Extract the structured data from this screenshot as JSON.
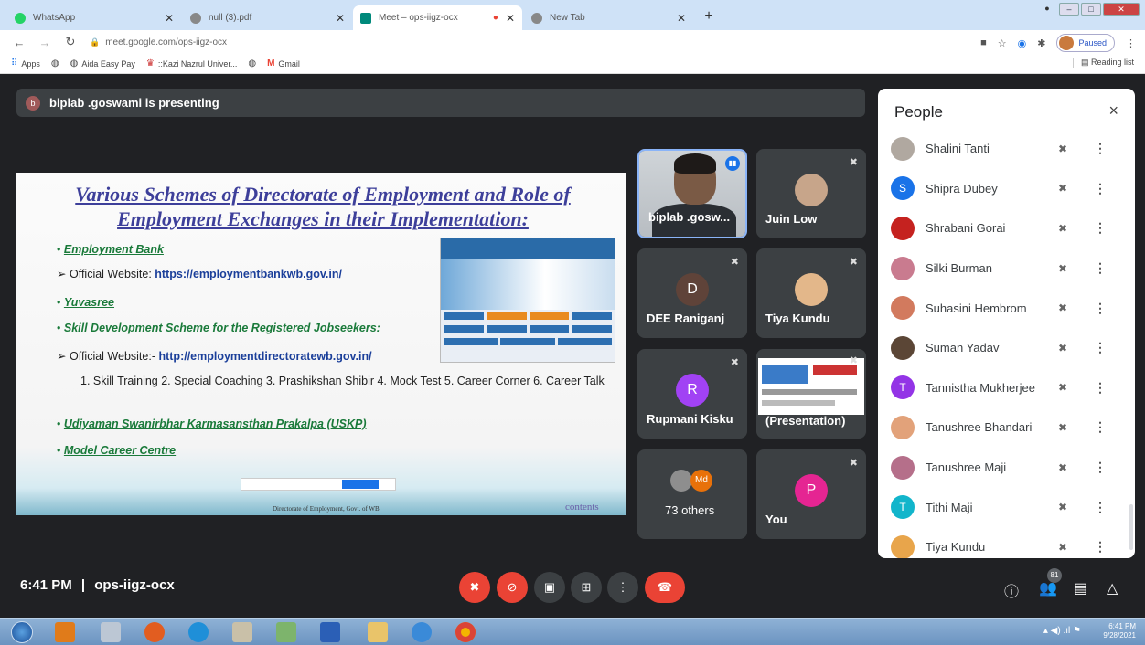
{
  "browser": {
    "tabs": [
      {
        "label": "WhatsApp",
        "favicon_color": "#25d366",
        "active": false
      },
      {
        "label": "null (3).pdf",
        "favicon_color": "#888888",
        "active": false
      },
      {
        "label": "Meet – ops-iigz-ocx",
        "favicon_color": "#00897b",
        "active": true
      },
      {
        "label": "New Tab",
        "favicon_color": "#888888",
        "active": false
      }
    ],
    "new_tab": "+",
    "url": "meet.google.com/ops-iigz-ocx",
    "profile_status": "Paused",
    "bookmarks": [
      {
        "label": "Apps",
        "icon": "grid-icon"
      },
      {
        "label": "",
        "icon": "globe-icon"
      },
      {
        "label": "Aida Easy Pay",
        "icon": "globe-icon"
      },
      {
        "label": "::Kazi Nazrul Univer...",
        "icon": "kazi-icon"
      },
      {
        "label": "",
        "icon": "globe-icon"
      },
      {
        "label": "Gmail",
        "icon": "gmail-icon"
      }
    ],
    "reading_list": "Reading list"
  },
  "meet": {
    "presenting_banner": "biplab .goswami is presenting",
    "presenter_initial": "b",
    "slide": {
      "title": "Various Schemes of Directorate of Employment and Role of Employment Exchanges in their Implementation:",
      "item1": "Employment Bank",
      "site1_label": "Official Website: ",
      "site1_url": "https://employmentbankwb.gov.in/",
      "item2": "Yuvasree",
      "item3": "Skill Development Scheme for the Registered Jobseekers:",
      "site2_label": "Official Website:- ",
      "site2_url": "http://employmentdirectoratewb.gov.in/",
      "courses": "1. Skill Training 2. Special Coaching 3. Prashikshan Shibir 4. Mock Test 5. Career Corner 6. Career Talk",
      "item4": "Udiyaman Swanirbhar Karmasansthan Prakalpa (USKP)",
      "item5": "Model Career Centre",
      "footer": "Directorate of Employment, Govt. of WB",
      "contents": "contents",
      "bullet": "•",
      "arrow": "➢"
    },
    "tiles": [
      {
        "name": "biplab .gosw...",
        "type": "camera"
      },
      {
        "name": "Juin Low",
        "type": "avatar-photo"
      },
      {
        "name": "DEE Raniganj",
        "initial": "D",
        "color": "#3c4043"
      },
      {
        "name": "Tiya Kundu",
        "type": "avatar-photo"
      },
      {
        "name": "Rupmani Kisku",
        "initial": "R",
        "color": "#a142f4"
      },
      {
        "name": "(Presentation)",
        "type": "presentation"
      },
      {
        "name": "73 others",
        "badge": "Md",
        "badge_color": "#e8710a"
      },
      {
        "name": "You",
        "initial": "P",
        "color": "#e52592"
      }
    ],
    "people_panel": {
      "title": "People",
      "close": "×",
      "participants": [
        {
          "name": "Shalini Tanti",
          "avatar": "photo",
          "color": "#b0a8a0"
        },
        {
          "name": "Shipra Dubey",
          "avatar": "S",
          "color": "#1a73e8"
        },
        {
          "name": "Shrabani Gorai",
          "avatar": "photo",
          "color": "#c5221f"
        },
        {
          "name": "Silki Burman",
          "avatar": "photo",
          "color": "#c97b8f"
        },
        {
          "name": "Suhasini Hembrom",
          "avatar": "photo",
          "color": "#d27a5e"
        },
        {
          "name": "Suman Yadav",
          "avatar": "photo",
          "color": "#5b4636"
        },
        {
          "name": "Tannistha Mukherjee",
          "avatar": "T",
          "color": "#9334e6"
        },
        {
          "name": "Tanushree Bhandari",
          "avatar": "photo",
          "color": "#e2a27a"
        },
        {
          "name": "Tanushree Maji",
          "avatar": "photo",
          "color": "#b56f8a"
        },
        {
          "name": "Tithi Maji",
          "avatar": "T",
          "color": "#12b5cb"
        },
        {
          "name": "Tiya Kundu",
          "avatar": "photo",
          "color": "#e8a54b"
        }
      ]
    },
    "time": "6:41 PM",
    "separator": "|",
    "meeting_code": "ops-iigz-ocx",
    "participant_count": "81"
  },
  "taskbar": {
    "time": "6:41 PM",
    "date": "9/28/2021"
  }
}
